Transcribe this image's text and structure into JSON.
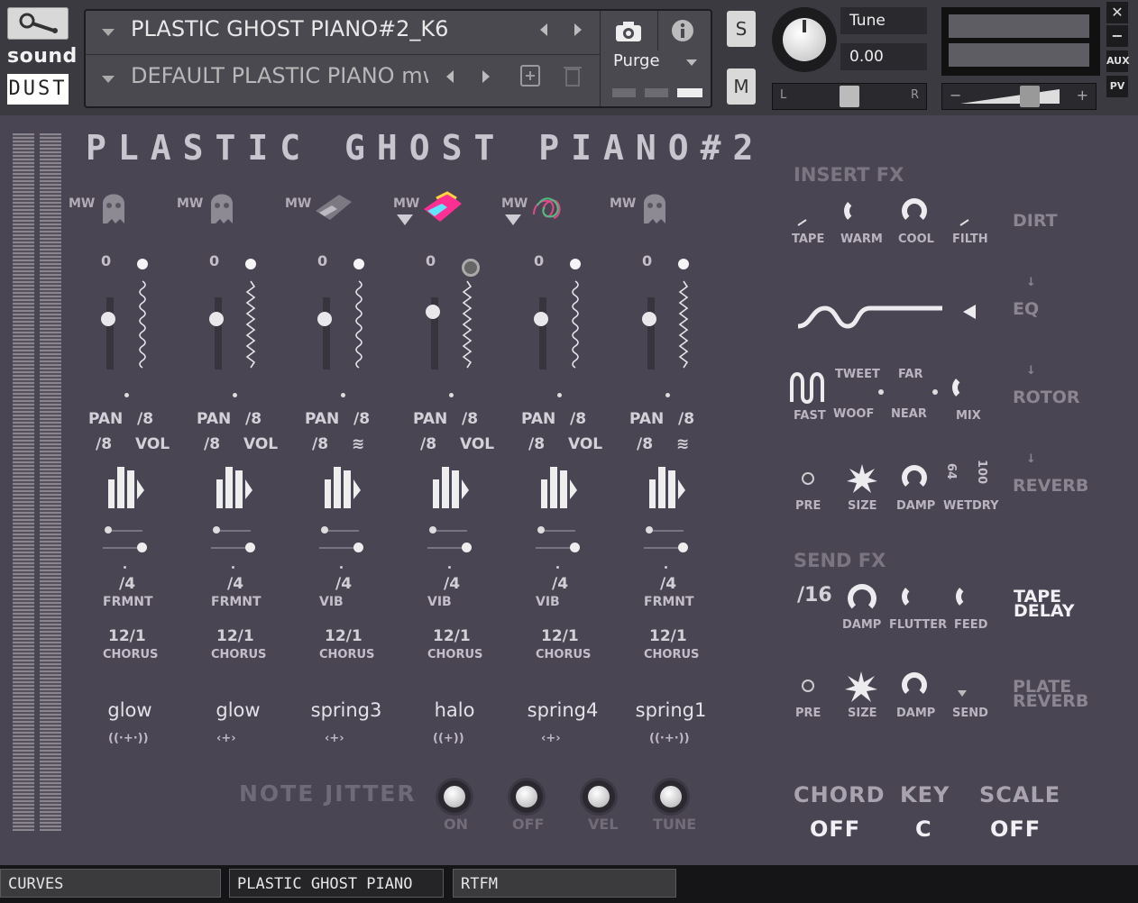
{
  "header": {
    "brand_top": "sound",
    "brand_bottom": "DUST",
    "instrument_name": "PLASTIC GHOST PIANO#2_K6",
    "preset_name": "DEFAULT PLASTIC PIANO mw",
    "purge_label": "Purge",
    "solo_label": "S",
    "mute_label": "M",
    "tune_label": "Tune",
    "tune_value": "0.00",
    "pan_left": "L",
    "pan_right": "R",
    "vol_minus": "−",
    "vol_plus": "+",
    "side_aux": "AUX",
    "side_pv": "PV",
    "close": "✕",
    "minimize": "−"
  },
  "main": {
    "title": "PLASTIC GHOST PIANO#2",
    "mw_label": "MW",
    "channels": [
      {
        "icon": "ghost-icon",
        "num": "0",
        "pan": "PAN",
        "div1": "/8",
        "div2": "/8",
        "mod": "VOL",
        "lfo_div": "/4",
        "lfo_type": "FRMNT",
        "chorus_val": "12/1",
        "chorus_lbl": "CHORUS",
        "preset": "glow",
        "arrow": false,
        "active": false
      },
      {
        "icon": "ghost-icon",
        "num": "0",
        "pan": "PAN",
        "div1": "/8",
        "div2": "/8",
        "mod": "VOL",
        "lfo_div": "/4",
        "lfo_type": "FRMNT",
        "chorus_val": "12/1",
        "chorus_lbl": "CHORUS",
        "preset": "glow",
        "arrow": false,
        "active": false
      },
      {
        "icon": "grand-piano-icon",
        "num": "0",
        "pan": "PAN",
        "div1": "/8",
        "div2": "/8",
        "mod": "≋",
        "lfo_div": "/4",
        "lfo_type": "VIB",
        "chorus_val": "12/1",
        "chorus_lbl": "CHORUS",
        "preset": "spring3",
        "arrow": false,
        "active": false
      },
      {
        "icon": "pink-piano-icon",
        "num": "0",
        "pan": "PAN",
        "div1": "/8",
        "div2": "/8",
        "mod": "VOL",
        "lfo_div": "/4",
        "lfo_type": "VIB",
        "chorus_val": "12/1",
        "chorus_lbl": "CHORUS",
        "preset": "halo",
        "arrow": true,
        "active": true
      },
      {
        "icon": "tangle-icon",
        "num": "0",
        "pan": "PAN",
        "div1": "/8",
        "div2": "/8",
        "mod": "VOL",
        "lfo_div": "/4",
        "lfo_type": "VIB",
        "chorus_val": "12/1",
        "chorus_lbl": "CHORUS",
        "preset": "spring4",
        "arrow": true,
        "active": false
      },
      {
        "icon": "ghost-icon",
        "num": "0",
        "pan": "PAN",
        "div1": "/8",
        "div2": "/8",
        "mod": "≋",
        "lfo_div": "/4",
        "lfo_type": "FRMNT",
        "chorus_val": "12/1",
        "chorus_lbl": "CHORUS",
        "preset": "spring1",
        "arrow": false,
        "active": false
      }
    ],
    "note_jitter": {
      "label": "NOTE JITTER",
      "knobs": [
        "ON",
        "OFF",
        "VEL",
        "TUNE"
      ]
    }
  },
  "fx": {
    "insert_head": "INSERT FX",
    "dirt": {
      "name": "DIRT",
      "labels": [
        "TAPE",
        "WARM",
        "COOL",
        "FILTH"
      ]
    },
    "eq": {
      "name": "EQ"
    },
    "rotor": {
      "name": "ROTOR",
      "labels": [
        "FAST",
        "WOOF",
        "TWEET",
        "NEAR",
        "FAR",
        "MIX"
      ]
    },
    "reverb": {
      "name": "REVERB",
      "labels": [
        "PRE",
        "SIZE",
        "DAMP",
        "WET",
        "DRY"
      ],
      "wet_val": "64",
      "dry_val": "100"
    },
    "send_head": "SEND FX",
    "tape_delay": {
      "name_line1": "TAPE",
      "name_line2": "DELAY",
      "div": "/16",
      "labels": [
        "DAMP",
        "FLUTTER",
        "FEED"
      ]
    },
    "plate_reverb": {
      "name_line1": "PLATE",
      "name_line2": "REVERB",
      "labels": [
        "PRE",
        "SIZE",
        "DAMP",
        "SEND"
      ]
    },
    "chord": {
      "chord_label": "CHORD",
      "chord_value": "OFF",
      "key_label": "KEY",
      "key_value": "C",
      "scale_label": "SCALE",
      "scale_value": "OFF"
    }
  },
  "footer": {
    "tabs": [
      "CURVES",
      "PLASTIC GHOST PIANO",
      "RTFM"
    ],
    "active_tab": "PLASTIC GHOST PIANO"
  }
}
